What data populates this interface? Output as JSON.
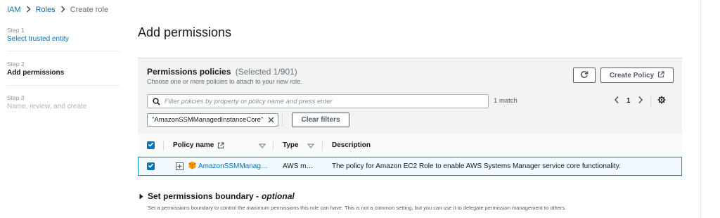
{
  "breadcrumb": {
    "iam": "IAM",
    "roles": "Roles",
    "current": "Create role"
  },
  "steps": [
    {
      "num": "Step 1",
      "name": "Select trusted entity"
    },
    {
      "num": "Step 2",
      "name": "Add permissions"
    },
    {
      "num": "Step 3",
      "name": "Name, review, and create"
    }
  ],
  "page_title": "Add permissions",
  "policies": {
    "title": "Permissions policies",
    "selected": "(Selected 1/901)",
    "description": "Choose one or more policies to attach to your new role.",
    "create_policy": "Create Policy",
    "search_placeholder": "Filter policies by property or policy name and press enter",
    "match_count": "1 match",
    "page": "1",
    "filter_token": "\"AmazonSSMManagedInstanceCore\"",
    "clear_filters": "Clear filters"
  },
  "table": {
    "headers": {
      "name": "Policy name",
      "type": "Type",
      "description": "Description"
    },
    "rows": [
      {
        "checked": true,
        "name": "AmazonSSMManag…",
        "type": "AWS m…",
        "description": "The policy for Amazon EC2 Role to enable AWS Systems Manager service core functionality."
      }
    ]
  },
  "boundary": {
    "title": "Set permissions boundary -",
    "optional": "optional",
    "description": "Set a permissions boundary to control the maximum permissions this role can have. This is not a common setting, but you can use it to delegate permission management to others."
  },
  "colors": {
    "link": "#0073bb",
    "accent": "#0073bb",
    "selected_row_bg": "#f1faff",
    "selected_row_border": "#00a1c9",
    "policy_icon": "#f90"
  }
}
